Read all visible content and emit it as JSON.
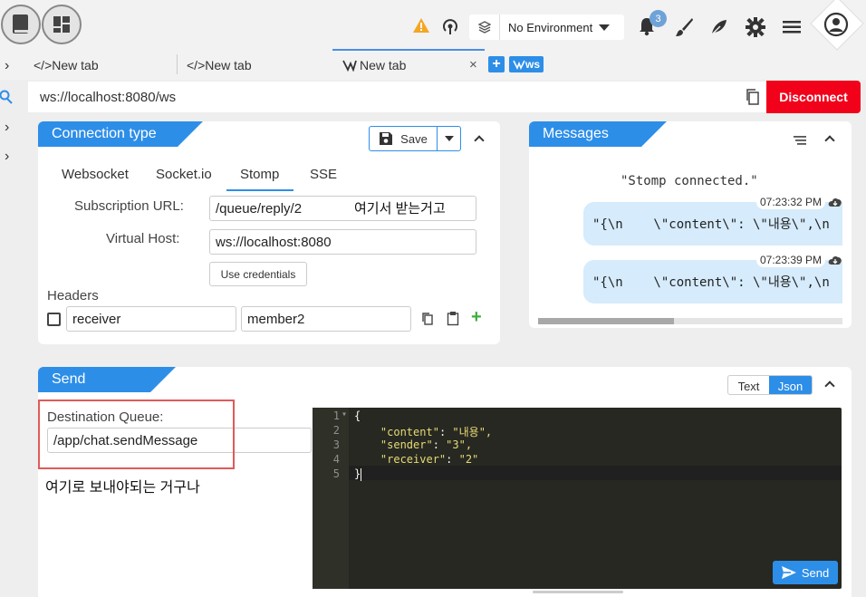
{
  "toolbar": {
    "environment": "No Environment",
    "notifications_count": "3"
  },
  "tabs": [
    {
      "label": "</>New tab"
    },
    {
      "label": "</>New tab"
    },
    {
      "label": "New tab"
    }
  ],
  "ws_label": "ws",
  "url": "ws://localhost:8080/ws",
  "disconnect_label": "Disconnect",
  "connection": {
    "title": "Connection type",
    "save_label": "Save",
    "subtabs": [
      "Websocket",
      "Socket.io",
      "Stomp",
      "SSE"
    ],
    "subscription_label": "Subscription URL:",
    "subscription_value": "/queue/reply/2",
    "subscription_note": "여기서 받는거고",
    "virtual_host_label": "Virtual Host:",
    "virtual_host_value": "ws://localhost:8080",
    "use_credentials": "Use credentials",
    "headers_label": "Headers",
    "header_key": "receiver",
    "header_value": "member2"
  },
  "messages": {
    "title": "Messages",
    "items": [
      {
        "text": "\"Stomp connected.\""
      },
      {
        "time": "07:23:32 PM",
        "text": "\"{\\n    \\\"content\\\": \\\"내용\\\",\\n"
      },
      {
        "time": "07:23:39 PM",
        "text": "\"{\\n    \\\"content\\\": \\\"내용\\\",\\n"
      }
    ]
  },
  "send": {
    "title": "Send",
    "text_toggle": "Text",
    "json_toggle": "Json",
    "dest_label": "Destination Queue:",
    "dest_value": "/app/chat.sendMessage",
    "dest_note": "여기로 보내야되는 거구나",
    "send_label": "Send",
    "code_lines": [
      {
        "n": "1",
        "code": "{"
      },
      {
        "n": "2",
        "key": "\"content\"",
        "val": "\"내용\","
      },
      {
        "n": "3",
        "key": "\"sender\"",
        "val": "\"3\","
      },
      {
        "n": "4",
        "key": "\"receiver\"",
        "val": "\"2\""
      },
      {
        "n": "5",
        "code": "}"
      }
    ]
  },
  "colors": {
    "accent": "#2d8ee8",
    "disconnect": "#f2021a",
    "warning": "#f5a623",
    "annotation_box": "#e05a5a"
  }
}
